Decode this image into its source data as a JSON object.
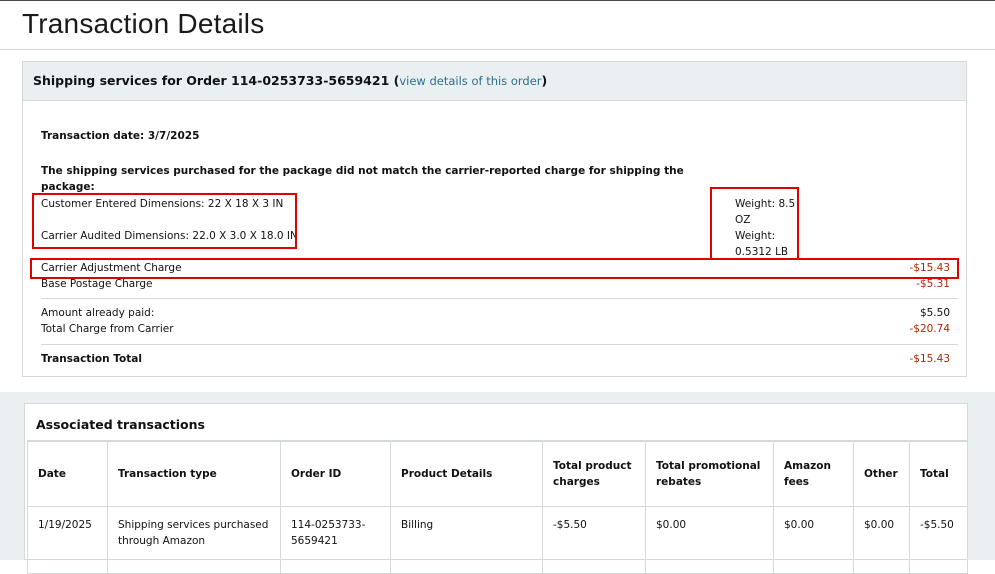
{
  "page_title": "Transaction Details",
  "shipping": {
    "header_prefix": "Shipping services for Order 114-0253733-5659421 (",
    "header_link": "view details of this order",
    "header_suffix": ")",
    "transaction_date": "Transaction date: 3/7/2025",
    "mismatch_line1": "The shipping services purchased for the package did not match the carrier-reported charge for shipping the",
    "mismatch_line2": "package:",
    "customer_dims": "Customer Entered Dimensions: 22 X 18 X 3 IN",
    "carrier_dims": "Carrier Audited Dimensions: 22.0 X 3.0 X 18.0 IN",
    "weight1_line1": "Weight: 8.5",
    "weight1_line2": "OZ",
    "weight2_line1": "Weight:",
    "weight2_line2": "0.5312 LB",
    "adjustment_label": "Carrier Adjustment Charge",
    "adjustment_amount": "-$15.43",
    "base_label": "Base Postage Charge",
    "base_amount": "-$5.31",
    "paid_label": "Amount already paid:",
    "paid_amount": "$5.50",
    "total_carrier_label": "Total Charge from Carrier",
    "total_carrier_amount": "-$20.74",
    "transaction_total_label": "Transaction Total",
    "transaction_total_amount": "-$15.43"
  },
  "associated": {
    "title": "Associated transactions",
    "columns": [
      "Date",
      "Transaction type",
      "Order ID",
      "Product Details",
      "Total product charges",
      "Total promotional rebates",
      "Amazon fees",
      "Other",
      "Total"
    ],
    "rows": [
      {
        "date": "1/19/2025",
        "type": "Shipping services purchased through Amazon",
        "order_id": "114-0253733-5659421",
        "product_details": "Billing",
        "product_charges": "-$5.50",
        "promo_rebates": "$0.00",
        "amazon_fees": "$0.00",
        "other": "$0.00",
        "total": "-$5.50"
      }
    ]
  },
  "colors": {
    "negative": "#b12704",
    "link": "#2a6f8a",
    "highlight_box": "#e00000",
    "header_bg": "#eaf0f2"
  }
}
